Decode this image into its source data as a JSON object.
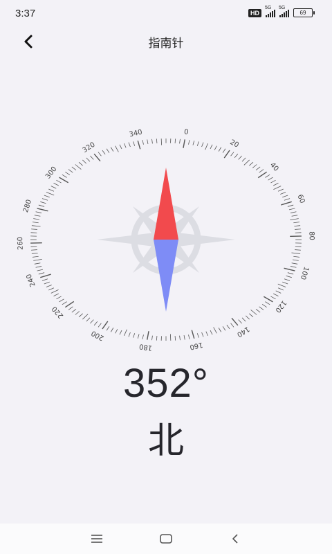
{
  "status_bar": {
    "time": "3:37",
    "hd_badge": "HD",
    "network_1": "5G",
    "network_2": "5G",
    "battery": "69"
  },
  "header": {
    "title": "指南针",
    "back_icon": "chevron-left-icon"
  },
  "compass": {
    "dial_labels": [
      "0",
      "20",
      "40",
      "60",
      "80",
      "100",
      "120",
      "140",
      "160",
      "180",
      "200",
      "220",
      "240",
      "260",
      "280",
      "300",
      "320",
      "340"
    ],
    "needle_north_color": "#f24a4d",
    "needle_south_color": "#7e8cf6",
    "rose_color": "#dcdde3",
    "heading_degrees": 352
  },
  "reading": {
    "heading": "352°",
    "direction": "北"
  },
  "nav_bar": {
    "menu_icon": "menu-icon",
    "home_icon": "home-icon",
    "back_icon": "back-icon"
  }
}
